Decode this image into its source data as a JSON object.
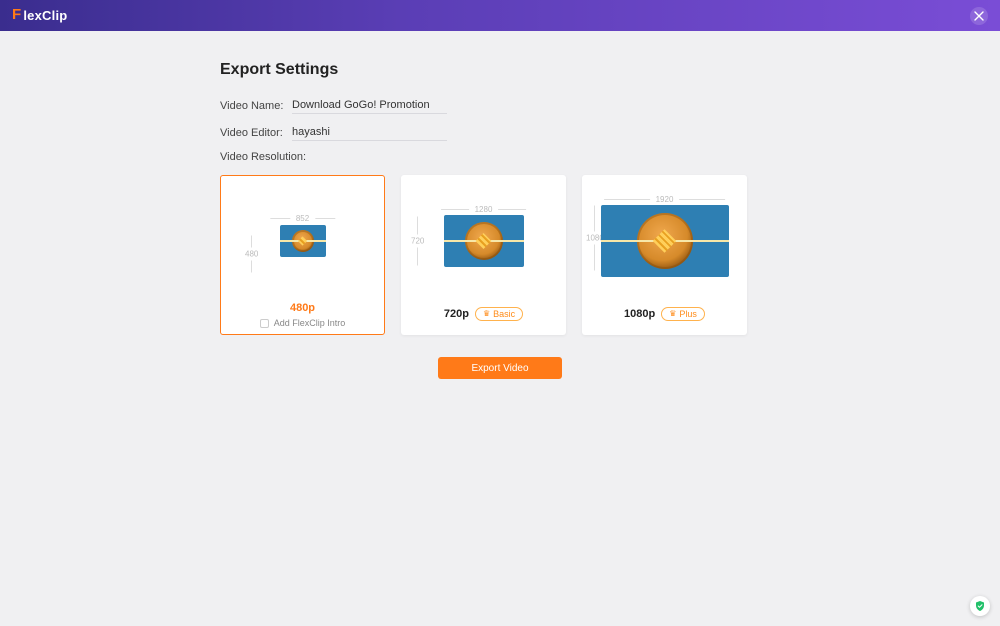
{
  "app": {
    "brand_prefix": "F",
    "brand_rest": "lexClip"
  },
  "header": {
    "close_aria": "Close"
  },
  "page": {
    "title": "Export Settings",
    "fields": {
      "name_label": "Video Name:",
      "name_value": "Download GoGo! Promotion",
      "editor_label": "Video Editor:",
      "editor_value": "hayashi",
      "resolution_label": "Video Resolution:"
    },
    "options": [
      {
        "res": "480p",
        "width": "852",
        "height": "480",
        "badge": null,
        "selected": true,
        "add_intro_label": "Add FlexClip Intro"
      },
      {
        "res": "720p",
        "width": "1280",
        "height": "720",
        "badge": "Basic",
        "selected": false
      },
      {
        "res": "1080p",
        "width": "1920",
        "height": "1080",
        "badge": "Plus",
        "selected": false
      }
    ],
    "export_button": "Export Video"
  },
  "colors": {
    "accent": "#ff7a18"
  }
}
